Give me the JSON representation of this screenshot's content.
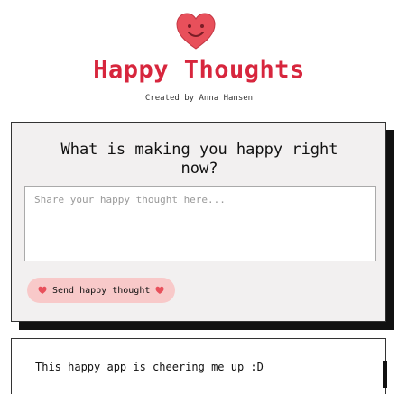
{
  "header": {
    "logo_icon": "heart-smiley-icon",
    "title": "Happy Thoughts",
    "credit": "Created by Anna Hansen"
  },
  "form": {
    "question": "What is making you happy right now?",
    "input_placeholder": "Share your happy thought here...",
    "input_value": "",
    "send_label": "Send happy thought",
    "send_icon": "heart-icon"
  },
  "thoughts": [
    {
      "message": "This happy app is cheering me up :D"
    }
  ],
  "colors": {
    "accent": "#d7263d",
    "card_background": "#f2f0f0",
    "button_background": "#f8c9c9",
    "heart": "#e8505b"
  }
}
